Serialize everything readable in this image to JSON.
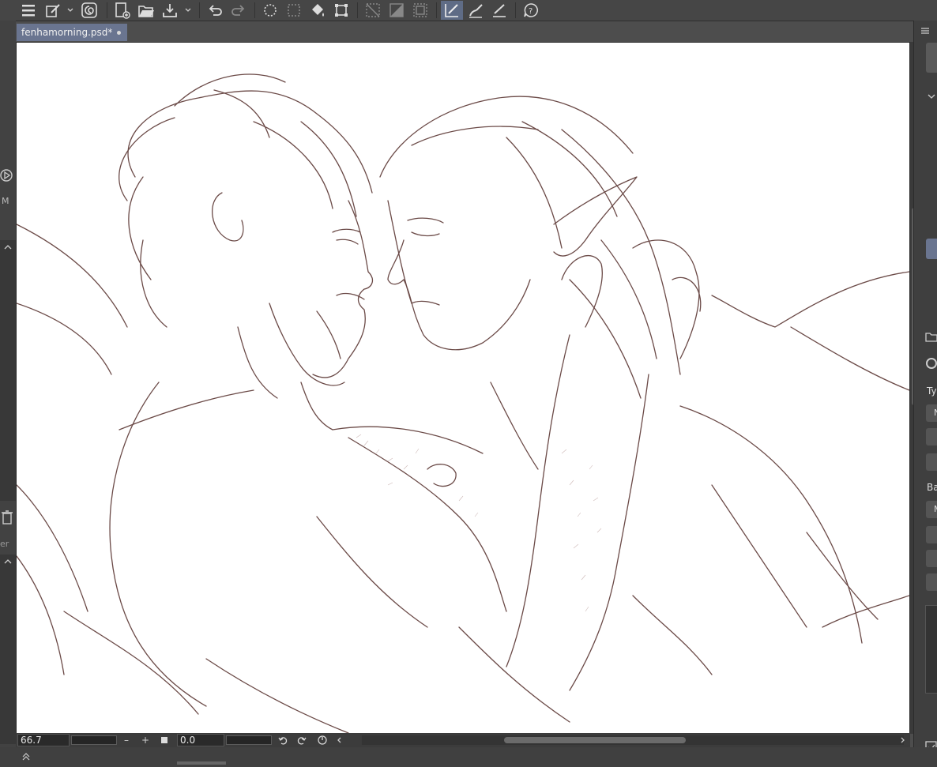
{
  "document": {
    "tab_title": "fenhamorning.psd*"
  },
  "toolbar": {
    "icons": [
      "menu-icon",
      "brush-tool-icon",
      "clip-studio-icon",
      "new-file-icon",
      "open-folder-icon",
      "save-icon",
      "undo-icon",
      "redo-icon",
      "selection-icon",
      "clear-selection-icon",
      "fill-icon",
      "transform-icon",
      "grid-icon",
      "ruler-icon",
      "frame-icon",
      "correct-line-icon",
      "stabilizer-icon",
      "snap-icon",
      "help-icon"
    ]
  },
  "left_panel": {
    "label_fragment": "M",
    "label_fragment2": "er"
  },
  "right_panel": {
    "label_ty": "Ty",
    "label_ba": "Ba",
    "btn_n": "N",
    "btn_m": "M"
  },
  "status_bar": {
    "zoom_value": "66.7",
    "zoom_out": "–",
    "zoom_in": "+",
    "angle_value": "0.0"
  },
  "colors": {
    "accent": "#6a7590",
    "line_art": "#6b4a47"
  }
}
